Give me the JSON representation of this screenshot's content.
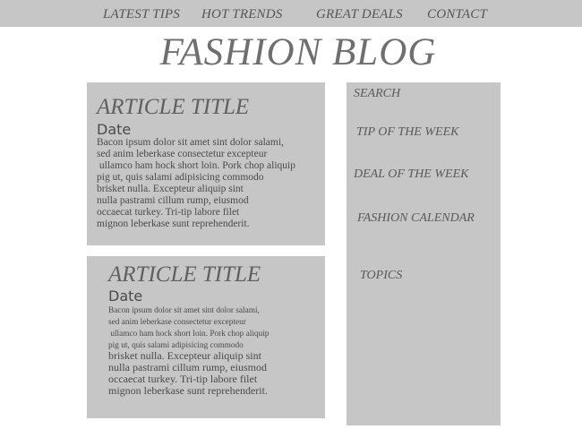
{
  "nav": {
    "items": [
      {
        "label": "LATEST TIPS"
      },
      {
        "label": "HOT TRENDS"
      },
      {
        "label": "GREAT DEALS"
      },
      {
        "label": "CONTACT"
      }
    ]
  },
  "header": {
    "title": "FASHION BLOG"
  },
  "articles": [
    {
      "title": "ARTICLE TITLE",
      "date": "Date",
      "body": "Bacon ipsum dolor sit amet sint dolor salami,\nsed anim leberkase consectetur excepteur\n ullamco ham hock short loin. Pork chop aliquip\npig ut, quis salami adipisicing commodo\nbrisket nulla. Excepteur aliquip sint\nnulla pastrami cillum rump, eiusmod\noccaecat turkey. Tri-tip labore filet\nmignon leberkase sunt reprehenderit."
    },
    {
      "title": "ARTICLE TITLE",
      "date": "Date",
      "body_small": "Bacon ipsum dolor sit amet sint dolor salami,\nsed anim leberkase consectetur excepteur\n ullamco ham hock short loin. Pork chop aliquip\npig ut, quis salami adipisicing commodo",
      "body_large": "brisket nulla. Excepteur aliquip sint\nnulla pastrami cillum rump, eiusmod\noccaecat turkey. Tri-tip labore filet\nmignon leberkase sunt reprehenderit."
    }
  ],
  "sidebar": {
    "search_label": "SEARCH",
    "tip_label": "TIP OF THE WEEK",
    "deal_label": "DEAL OF THE WEEK",
    "calendar_label": "FASHION CALENDAR",
    "topics_label": "TOPICS"
  },
  "colors": {
    "panel": "#c6c6c6",
    "text": "#5a5a5a",
    "background": "#ffffff"
  }
}
